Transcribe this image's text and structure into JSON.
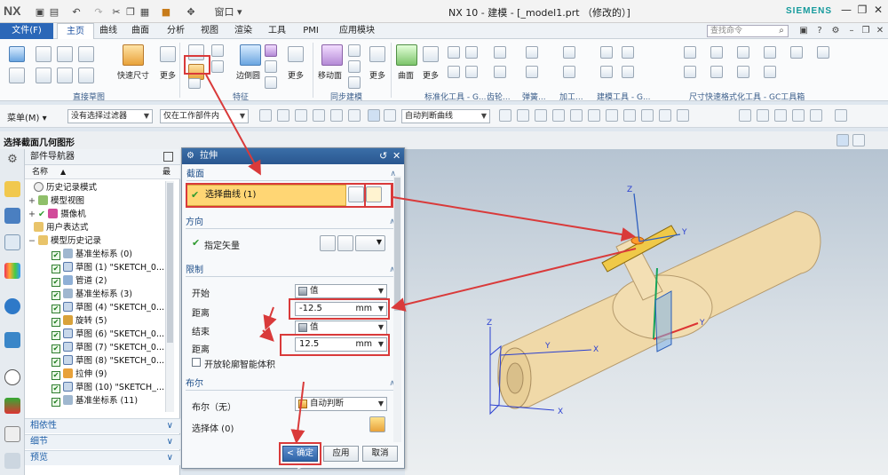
{
  "window": {
    "logo": "NX",
    "title": "NX 10 - 建模 - [_model1.prt （修改的）]",
    "brand": "SIEMENS",
    "window_menu": "窗口"
  },
  "tabs": {
    "file": "文件(F)",
    "items": [
      "主页",
      "曲线",
      "曲面",
      "分析",
      "视图",
      "渲染",
      "工具",
      "PMI",
      "应用模块"
    ],
    "active": "主页",
    "search_placeholder": "查找命令"
  },
  "ribbon": {
    "labels": {
      "quick_dim": "快速尺寸",
      "more1": "更多",
      "edge_blend": "边倒圆",
      "more2": "更多",
      "move_face": "移动面",
      "more3": "更多",
      "surface": "曲面",
      "more4": "更多"
    },
    "groups": [
      "直接草图",
      "特征",
      "同步建模",
      "标准化工具 - G...",
      "齿轮...",
      "弹簧...",
      "加工...",
      "建模工具 - G...",
      "尺寸快速格式化工具 - GC工具箱"
    ]
  },
  "selection_bar": {
    "menu": "菜单(M)",
    "filter": "没有选择过滤器",
    "scope": "仅在工作部件内",
    "curve_rule": "自动判断曲线"
  },
  "status": "选择截面几何图形",
  "navigator": {
    "title": "部件导航器",
    "col_name": "名称",
    "col_latest": "最",
    "items": [
      {
        "label": "历史记录模式",
        "indent": 1
      },
      {
        "label": "模型视图",
        "indent": 1
      },
      {
        "label": "摄像机",
        "indent": 1
      },
      {
        "label": "用户表达式",
        "indent": 1
      },
      {
        "label": "模型历史记录",
        "indent": 1
      },
      {
        "label": "基准坐标系 (0)",
        "indent": 2
      },
      {
        "label": "草图 (1) \"SKETCH_0...",
        "indent": 2
      },
      {
        "label": "管道 (2)",
        "indent": 2
      },
      {
        "label": "基准坐标系 (3)",
        "indent": 2
      },
      {
        "label": "草图 (4) \"SKETCH_0...",
        "indent": 2
      },
      {
        "label": "旋转 (5)",
        "indent": 2
      },
      {
        "label": "草图 (6) \"SKETCH_0...",
        "indent": 2
      },
      {
        "label": "草图 (7) \"SKETCH_0...",
        "indent": 2
      },
      {
        "label": "草图 (8) \"SKETCH_0...",
        "indent": 2
      },
      {
        "label": "拉伸 (9)",
        "indent": 2
      },
      {
        "label": "草图 (10) \"SKETCH_...",
        "indent": 2
      },
      {
        "label": "基准坐标系 (11)",
        "indent": 2
      }
    ],
    "sections": [
      "相依性",
      "细节",
      "预览"
    ]
  },
  "dialog": {
    "title": "拉伸",
    "section_section": "截面",
    "select_curve": "选择曲线 (1)",
    "section_direction": "方向",
    "specify_vector": "指定矢量",
    "section_limits": "限制",
    "start_label": "开始",
    "start_option": "值",
    "distance_label": "距离",
    "start_distance": "-12.5",
    "end_label": "结束",
    "end_option": "值",
    "end_distance": "12.5",
    "unit": "mm",
    "open_profile": "开放轮廓智能体积",
    "section_boolean": "布尔",
    "boolean_label": "布尔（无）",
    "boolean_option": "自动判断",
    "select_body": "选择体 (0)",
    "ok": "< 确定 >",
    "apply": "应用",
    "cancel": "取消"
  },
  "colors": {
    "accent": "#2b67b8",
    "annotation": "#d93a3a",
    "selection": "#ffd674",
    "part": "#f0d9a8"
  }
}
